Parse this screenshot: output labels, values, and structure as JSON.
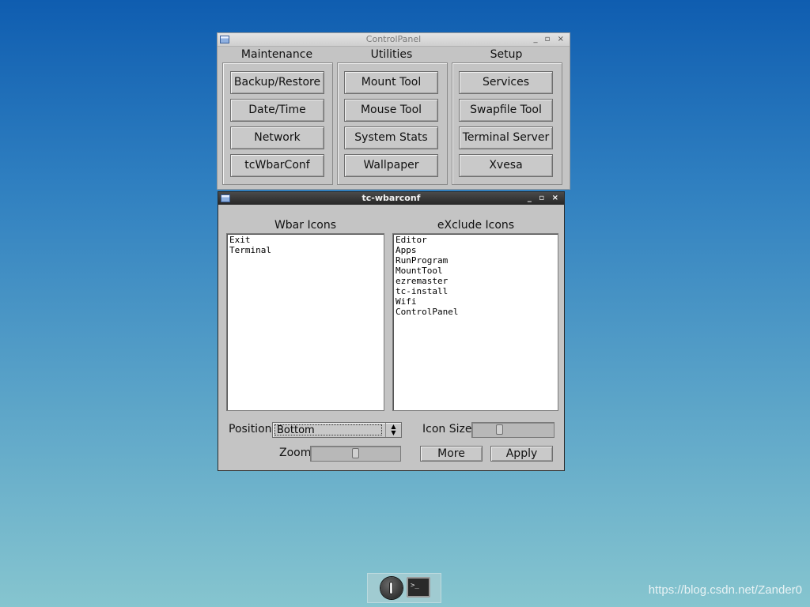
{
  "control_panel": {
    "title": "ControlPanel",
    "window_buttons": "_ ▫ ×",
    "columns": [
      {
        "title": "Maintenance",
        "buttons": [
          "Backup/Restore",
          "Date/Time",
          "Network",
          "tcWbarConf"
        ]
      },
      {
        "title": "Utilities",
        "buttons": [
          "Mount Tool",
          "Mouse Tool",
          "System Stats",
          "Wallpaper"
        ]
      },
      {
        "title": "Setup",
        "buttons": [
          "Services",
          "Swapfile Tool",
          "Terminal Server",
          "Xvesa"
        ]
      }
    ]
  },
  "wbarconf": {
    "title": "tc-wbarconf",
    "window_buttons": "_ ▫ ×",
    "wbar_label": "Wbar Icons",
    "exclude_label": "eXclude Icons",
    "wbar_items": [
      "Exit",
      "Terminal"
    ],
    "exclude_items": [
      "Editor",
      "Apps",
      "RunProgram",
      "MountTool",
      "ezremaster",
      "tc-install",
      "Wifi",
      "ControlPanel"
    ],
    "position_label": "Position",
    "position_value": "Bottom",
    "icon_size_label": "Icon Size",
    "zoom_label": "Zoom",
    "more_label": "More",
    "apply_label": "Apply"
  },
  "taskbar": {
    "icons": [
      "power-icon",
      "terminal-icon"
    ],
    "terminal_glyph": ">_"
  },
  "watermark": "https://blog.csdn.net/Zander0"
}
